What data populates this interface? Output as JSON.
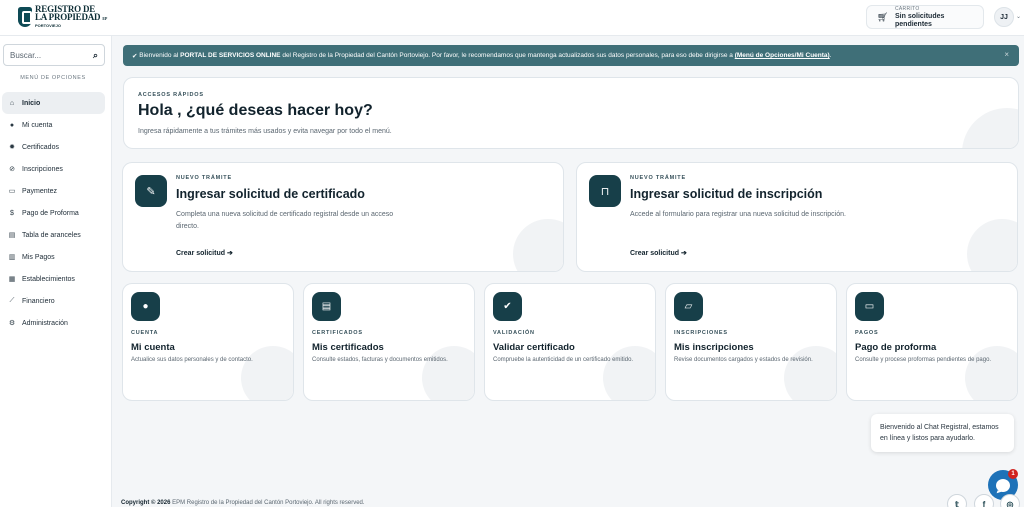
{
  "header": {
    "logo": {
      "line1": "REGISTRO DE",
      "line2": "LA PROPIEDAD",
      "suffix": "EP",
      "line3": "PORTOVIEJO"
    },
    "cart": {
      "label": "CARRITO",
      "status": "Sin solicitudes pendientes",
      "icon": "cart-icon"
    },
    "user": {
      "initials": "JJ"
    }
  },
  "sidebar": {
    "search_placeholder": "Buscar...",
    "menu_title": "MENÚ DE OPCIONES",
    "items": [
      {
        "label": "Inicio",
        "icon": "home-icon",
        "glyph": "⌂"
      },
      {
        "label": "Mi cuenta",
        "icon": "user-icon",
        "glyph": "●"
      },
      {
        "label": "Certificados",
        "icon": "certificate-icon",
        "glyph": "✹"
      },
      {
        "label": "Inscripciones",
        "icon": "inscriptions-icon",
        "glyph": "⊘"
      },
      {
        "label": "Paymentez",
        "icon": "card-icon",
        "glyph": "▭"
      },
      {
        "label": "Pago de Proforma",
        "icon": "dollar-icon",
        "glyph": "$"
      },
      {
        "label": "Tabla de aranceles",
        "icon": "table-icon",
        "glyph": "▤"
      },
      {
        "label": "Mis Pagos",
        "icon": "payments-icon",
        "glyph": "▥"
      },
      {
        "label": "Establecimientos",
        "icon": "building-icon",
        "glyph": "▦"
      },
      {
        "label": "Financiero",
        "icon": "chart-icon",
        "glyph": "⟋"
      },
      {
        "label": "Administración",
        "icon": "settings-icon",
        "glyph": "⚙"
      }
    ]
  },
  "banner": {
    "pre": "Bienvenido al",
    "portal": "PORTAL DE SERVICIOS ONLINE",
    "mid": "del Registro de la Propiedad del Cantón Portoviejo. Por favor, le recomendamos que mantenga actualizados sus datos personales, para eso debe dirigirse a",
    "link": "(Menú de Opciones/Mi Cuenta)",
    "end": ".",
    "close": "×"
  },
  "quick": {
    "eyebrow": "ACCESOS RÁPIDOS",
    "title": "Hola , ¿qué deseas hacer hoy?",
    "subtitle": "Ingresa rápidamente a tus trámites más usados y evita navegar por todo el menú."
  },
  "big_cards": [
    {
      "eyebrow": "NUEVO TRÁMITE",
      "title": "Ingresar solicitud de certificado",
      "desc": "Completa una nueva solicitud de certificado registral desde un acceso directo.",
      "cta": "Crear solicitud",
      "icon": "edit-icon"
    },
    {
      "eyebrow": "NUEVO TRÁMITE",
      "title": "Ingresar solicitud de inscripción",
      "desc": "Accede al formulario para registrar una nueva solicitud de inscripción.",
      "cta": "Crear solicitud",
      "icon": "bookmark-icon"
    }
  ],
  "small_cards": [
    {
      "eyebrow": "CUENTA",
      "title": "Mi cuenta",
      "desc": "Actualice sus datos personales y de contacto.",
      "icon": "user-icon"
    },
    {
      "eyebrow": "CERTIFICADOS",
      "title": "Mis certificados",
      "desc": "Consulte estados, facturas y documentos emitidos.",
      "icon": "document-icon"
    },
    {
      "eyebrow": "VALIDACIÓN",
      "title": "Validar certificado",
      "desc": "Compruebe la autenticidad de un certificado emitido.",
      "icon": "check-circle-icon"
    },
    {
      "eyebrow": "INSCRIPCIONES",
      "title": "Mis inscripciones",
      "desc": "Revise documentos cargados y estados de revisión.",
      "icon": "folder-icon"
    },
    {
      "eyebrow": "PAGOS",
      "title": "Pago de proforma",
      "desc": "Consulte y procese proformas pendientes de pago.",
      "icon": "credit-card-icon"
    }
  ],
  "chat": {
    "message": "Bienvenido al Chat Registral, estamos en línea y listos para ayudarlo.",
    "badge": "1"
  },
  "footer": {
    "copyright": "Copyright © 2026",
    "text": "EPM Registro de la Propiedad del Cantón Portoviejo. All rights reserved.",
    "social": [
      "twitter-icon",
      "facebook-icon",
      "instagram-icon"
    ]
  },
  "colors": {
    "primary": "#173f49",
    "banner": "#3f6f78",
    "chat": "#1e72b8",
    "badge": "#d0231f"
  }
}
